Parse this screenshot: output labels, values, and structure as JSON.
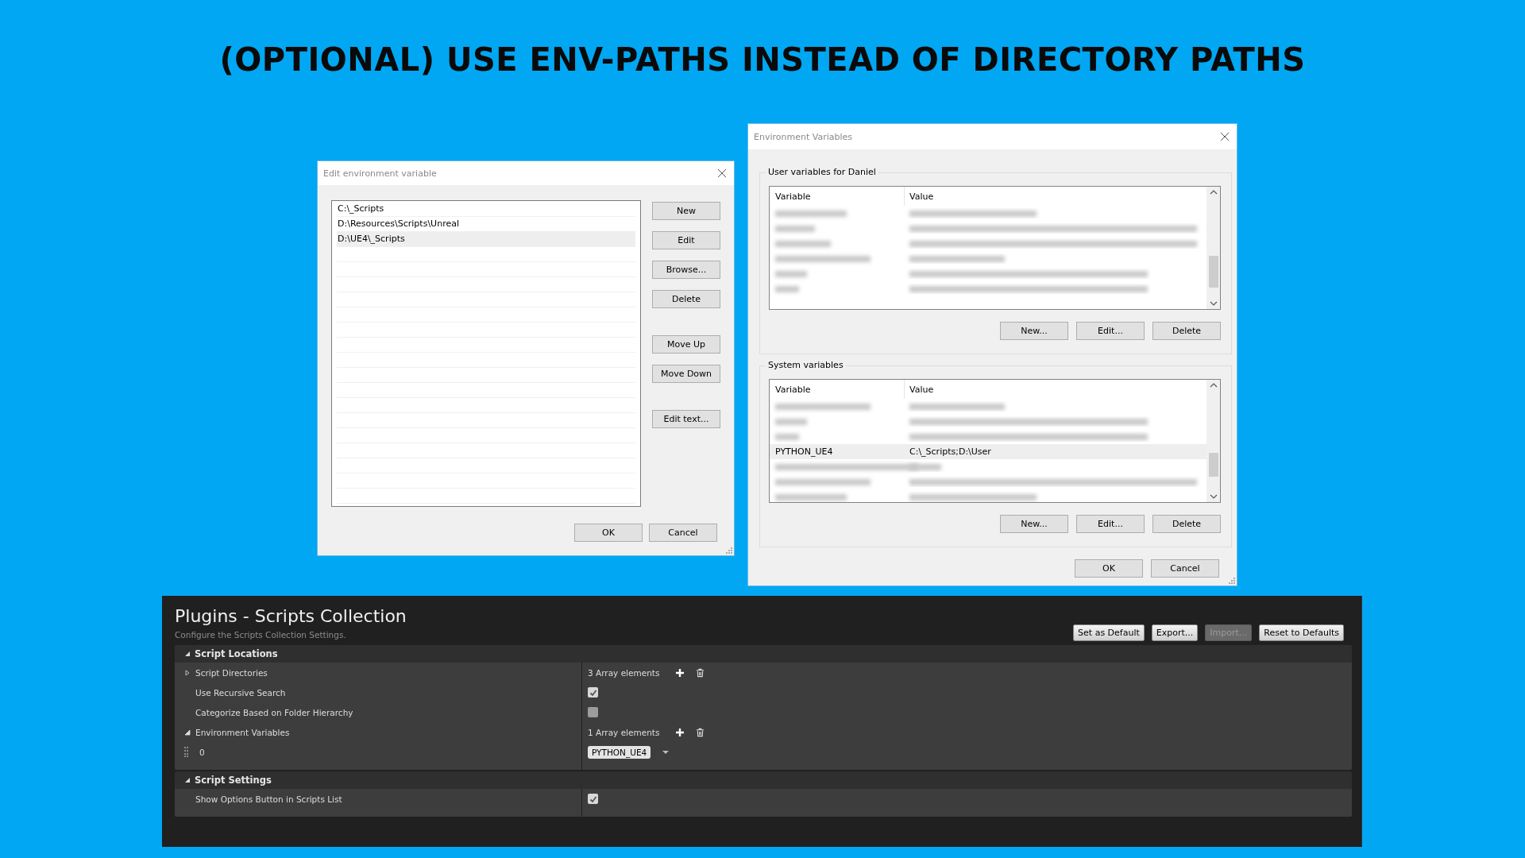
{
  "heading": "(OPTIONAL) USE ENV-PATHS INSTEAD OF DIRECTORY PATHS",
  "edit_dialog": {
    "title": "Edit environment variable",
    "entries": [
      {
        "text": "C:\\_Scripts",
        "selected": false
      },
      {
        "text": "D:\\Resources\\Scripts\\Unreal",
        "selected": false
      },
      {
        "text": "D:\\UE4\\_Scripts",
        "selected": true
      }
    ],
    "button_groups": [
      [
        "New",
        "Edit",
        "Browse...",
        "Delete"
      ],
      [
        "Move Up",
        "Move Down"
      ],
      [
        "Edit text..."
      ]
    ],
    "buttons": [
      "OK",
      "Cancel"
    ]
  },
  "env_dialog": {
    "title": "Environment Variables",
    "sections": [
      {
        "title": "User variables for Daniel",
        "columns": [
          "Variable",
          "Value"
        ],
        "rows": [
          {
            "kind": "blurred"
          },
          {
            "kind": "blurred"
          },
          {
            "kind": "blurred"
          },
          {
            "kind": "blurred"
          },
          {
            "kind": "blurred"
          },
          {
            "kind": "blurred"
          }
        ],
        "buttons": [
          "New...",
          "Edit...",
          "Delete"
        ]
      },
      {
        "title": "System variables",
        "columns": [
          "Variable",
          "Value"
        ],
        "rows": [
          {
            "kind": "blurred"
          },
          {
            "kind": "blurred"
          },
          {
            "kind": "blurred"
          },
          {
            "kind": "text",
            "variable": "PYTHON_UE4",
            "value": "C:\\_Scripts;D:\\User",
            "selected": true
          },
          {
            "kind": "blurred"
          },
          {
            "kind": "blurred"
          },
          {
            "kind": "blurred"
          }
        ],
        "buttons": [
          "New...",
          "Edit...",
          "Delete"
        ]
      }
    ],
    "buttons": [
      "OK",
      "Cancel"
    ]
  },
  "settings": {
    "title": "Plugins - Scripts Collection",
    "subtitle": "Configure the Scripts Collection Settings.",
    "buttons": [
      {
        "label": "Set as Default",
        "disabled": false
      },
      {
        "label": "Export...",
        "disabled": false
      },
      {
        "label": "Import...",
        "disabled": true
      },
      {
        "label": "Reset to Defaults",
        "disabled": false
      }
    ],
    "categories": [
      {
        "title": "Script Locations",
        "expanded": true,
        "properties": [
          {
            "kind": "array",
            "label": "Script Directories",
            "expanded": false,
            "count": "3 Array elements"
          },
          {
            "kind": "checkbox",
            "label": "Use Recursive Search",
            "checked": true
          },
          {
            "kind": "checkbox",
            "label": "Categorize Based on Folder Hierarchy",
            "checked": false
          },
          {
            "kind": "array",
            "label": "Environment Variables",
            "expanded": true,
            "count": "1 Array elements",
            "children": [
              {
                "label": "0",
                "value": "PYTHON_UE4"
              }
            ]
          }
        ]
      },
      {
        "title": "Script Settings",
        "expanded": true,
        "properties": [
          {
            "kind": "checkbox",
            "label": "Show Options Button in Scripts List",
            "checked": true
          }
        ]
      }
    ]
  }
}
